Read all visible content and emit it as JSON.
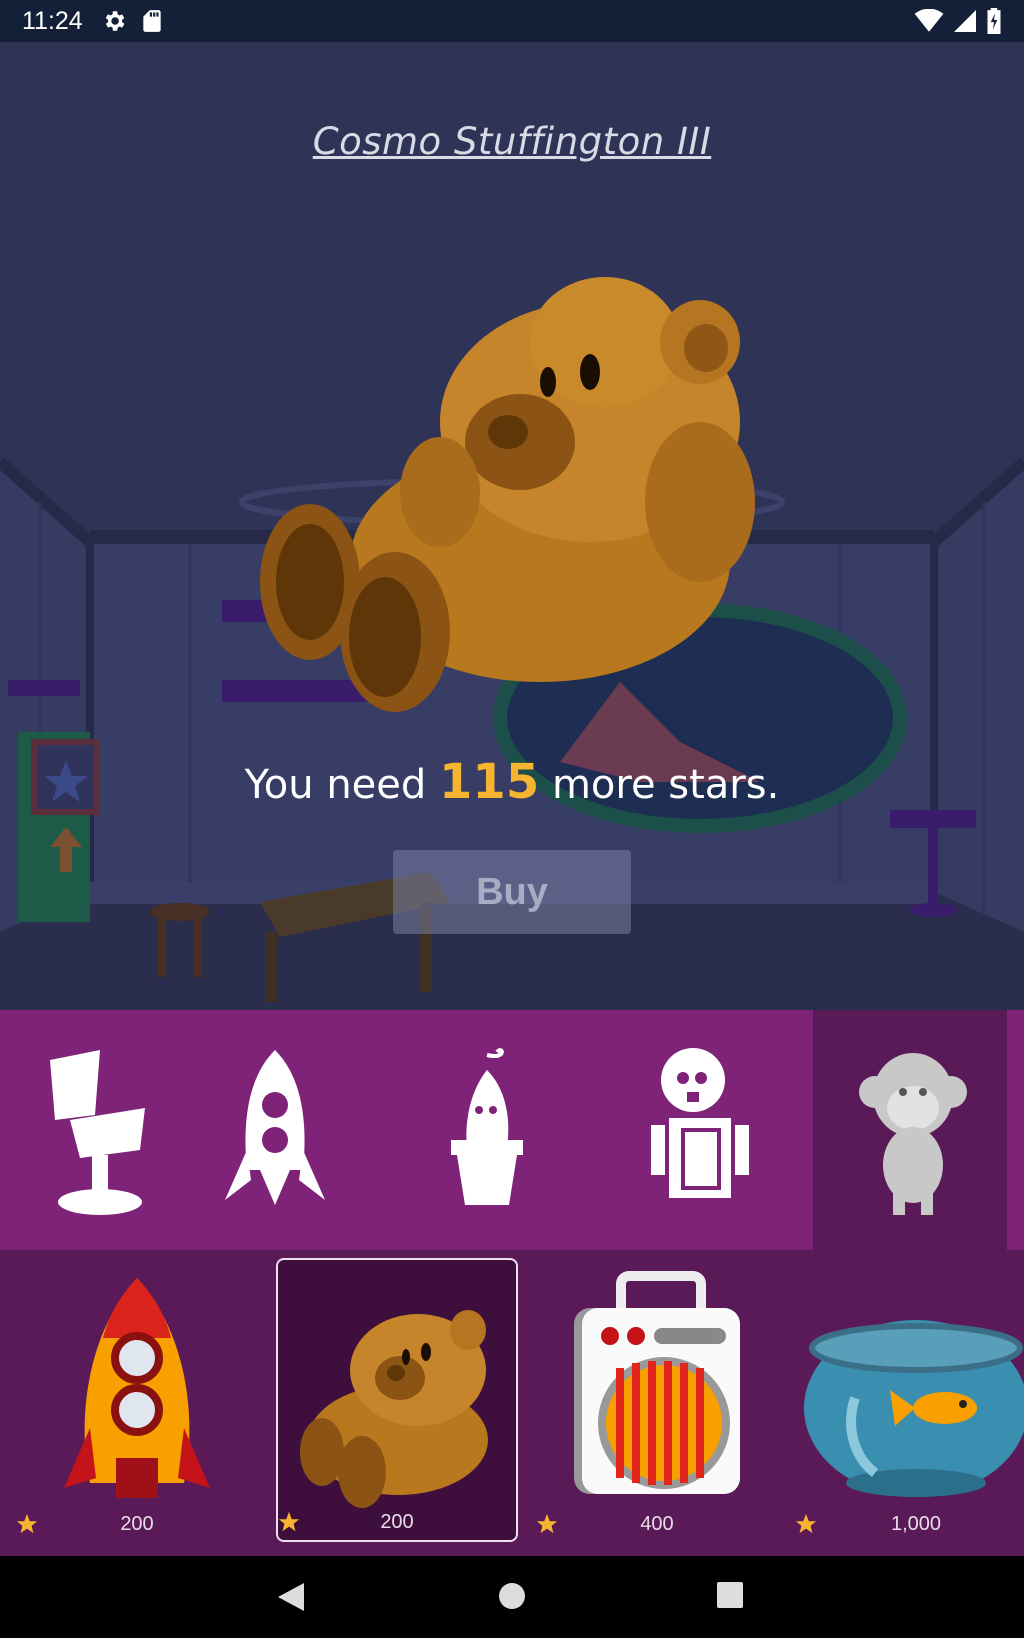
{
  "status_bar": {
    "time": "11:24",
    "left_icons": [
      "gear-icon",
      "sd-card-icon"
    ],
    "right_icons": [
      "wifi-icon",
      "signal-icon",
      "battery-charging-icon"
    ]
  },
  "detail": {
    "title": "Cosmo Stuffington III",
    "need_prefix": "You need",
    "need_count": "115",
    "need_suffix": "more stars.",
    "buy_label": "Buy",
    "buy_enabled": false
  },
  "categories": [
    {
      "name": "chair",
      "icon": "chair-icon",
      "selected": false
    },
    {
      "name": "rocket",
      "icon": "rocket-icon",
      "selected": false
    },
    {
      "name": "plant",
      "icon": "potted-plant-icon",
      "selected": false
    },
    {
      "name": "robot",
      "icon": "robot-icon",
      "selected": false
    },
    {
      "name": "monkey",
      "icon": "monkey-icon",
      "selected": true
    }
  ],
  "items": [
    {
      "name": "rocket",
      "price": "200",
      "selected": false
    },
    {
      "name": "teddy-bear",
      "price": "200",
      "selected": true
    },
    {
      "name": "space-heater",
      "price": "400",
      "selected": false
    },
    {
      "name": "fishbowl",
      "price": "1,000",
      "selected": false
    }
  ],
  "colors": {
    "accent_star": "#f6b431",
    "category_bg": "#7e2378",
    "shop_bg": "#5a1a58",
    "scene_bg": "#2e3355"
  }
}
